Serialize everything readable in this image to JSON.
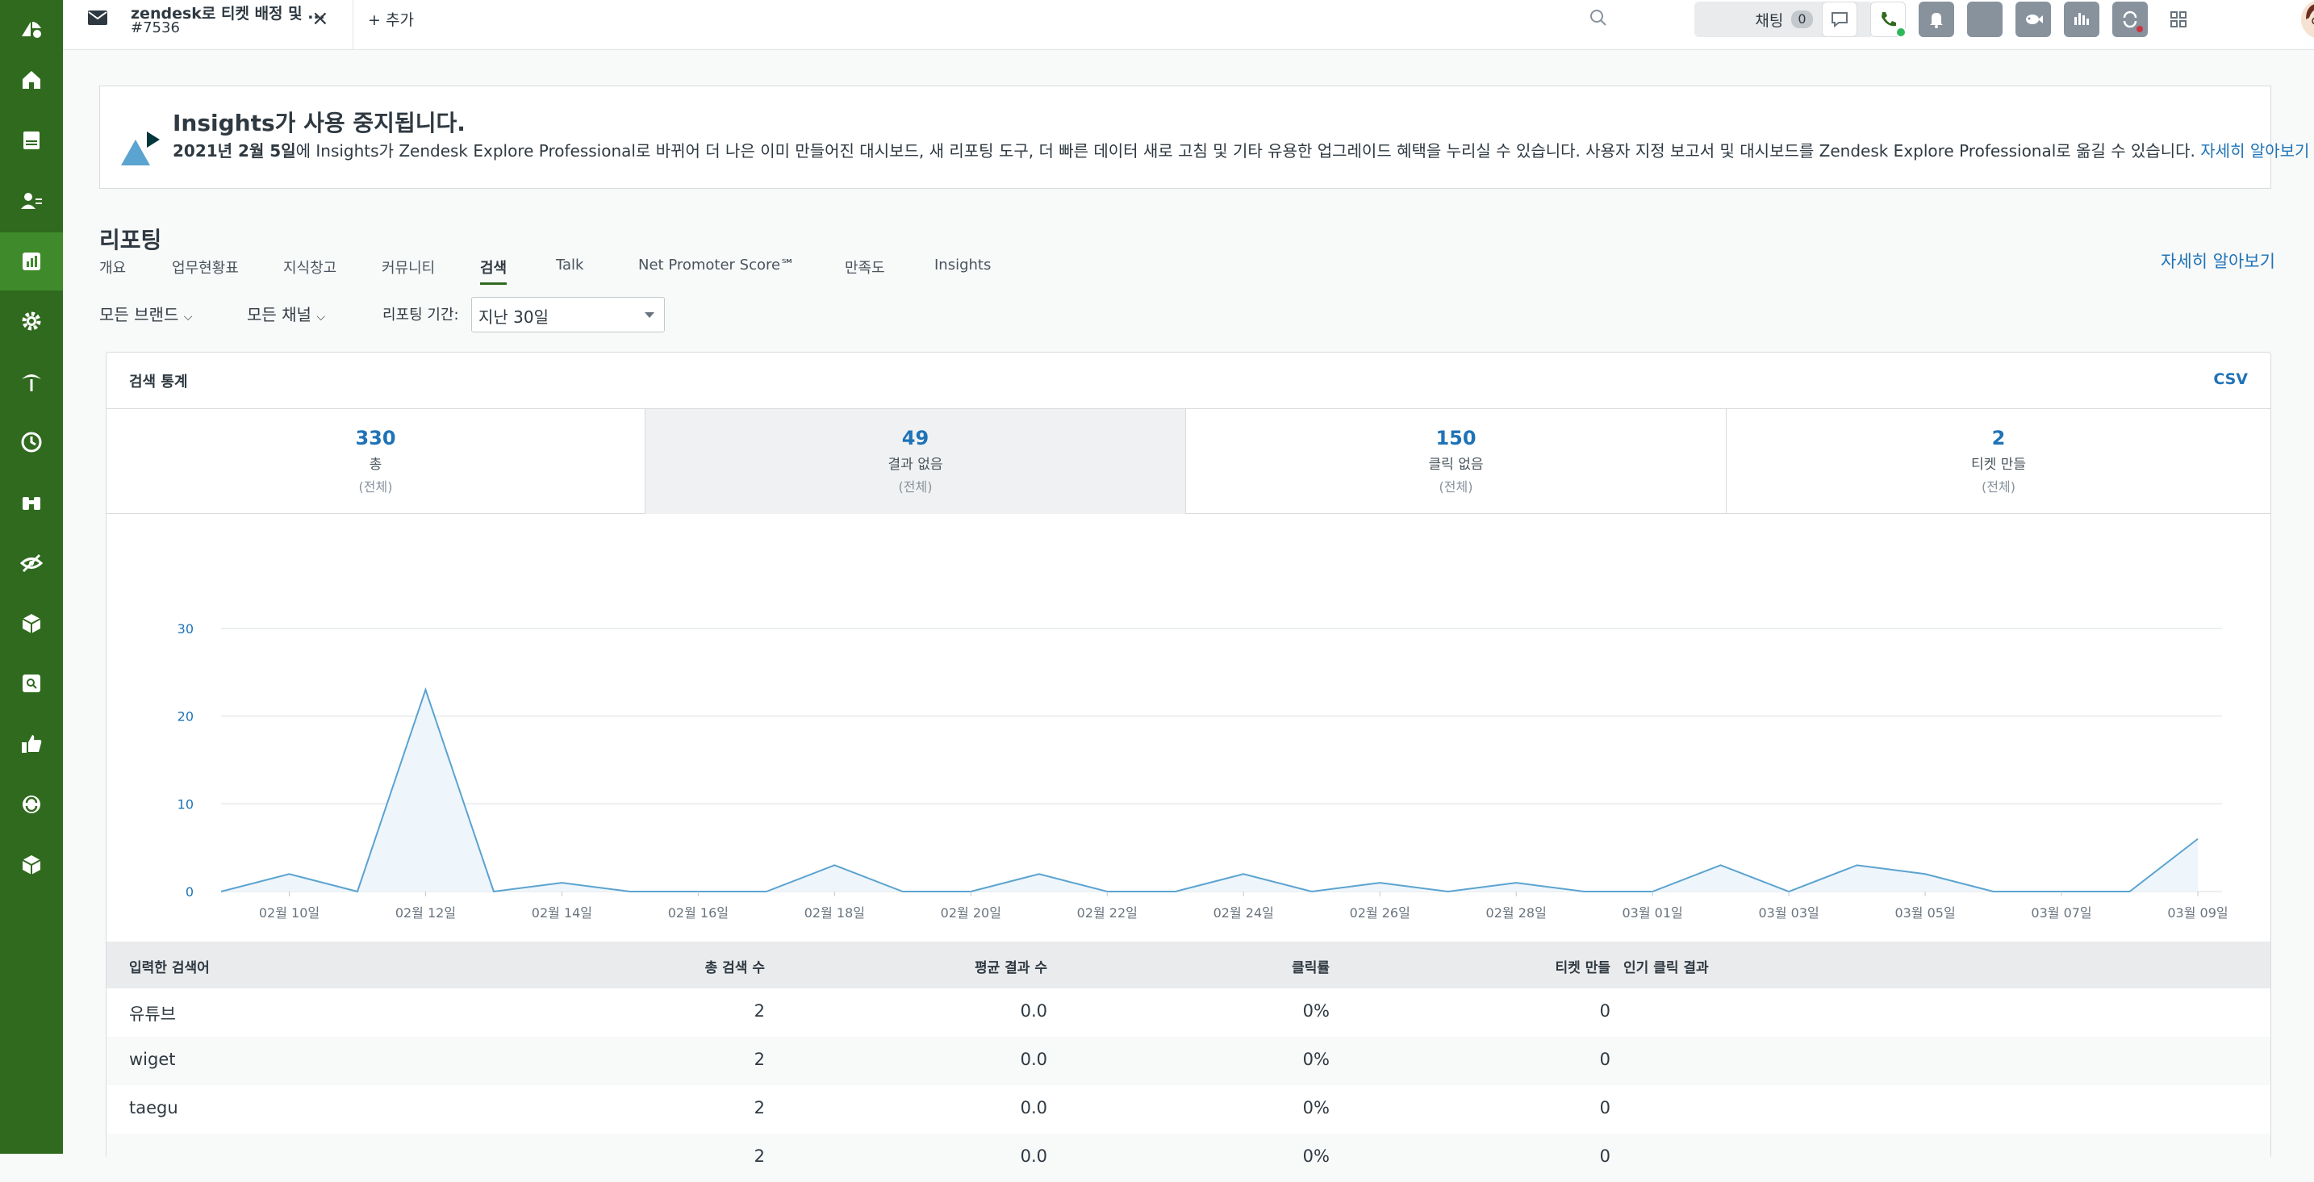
{
  "topbar": {
    "ticket_title": "zendesk로 티켓 배정 및 ...",
    "ticket_number": "#7536",
    "add_label": "+ 추가",
    "chat_label": "채팅",
    "chat_count": "0"
  },
  "banner": {
    "title": "Insights가 사용 중지됩니다.",
    "date": "2021년 2월 5일",
    "body": "에 Insights가 Zendesk Explore Professional로 바뀌어 더 나은 이미 만들어진 대시보드, 새 리포팅 도구, 더 빠른 데이터 새로 고침 및 기타 유용한 업그레이드 혜택을 누리실 수 있습니다. 사용자 지정 보고서 및 대시보드를 Zendesk Explore Professional로 옮길 수 있습니다.",
    "link": "자세히 알아보기"
  },
  "page": {
    "title": "리포팅",
    "learn_more": "자세히 알아보기",
    "tabs": [
      "개요",
      "업무현황표",
      "지식창고",
      "커뮤니티",
      "검색",
      "Talk",
      "Net Promoter Score℠",
      "만족도",
      "Insights"
    ],
    "active_tab": "검색"
  },
  "filters": {
    "brand": "모든 브랜드",
    "channel": "모든 채널",
    "period_label": "리포팅 기간:",
    "period_value": "지난 30일"
  },
  "panel": {
    "title": "검색 통계",
    "csv": "CSV",
    "stats": [
      {
        "value": "330",
        "label": "총",
        "sub": "(전체)"
      },
      {
        "value": "49",
        "label": "결과 없음",
        "sub": "(전체)"
      },
      {
        "value": "150",
        "label": "클릭 없음",
        "sub": "(전체)"
      },
      {
        "value": "2",
        "label": "티켓 만들",
        "sub": "(전체)"
      }
    ]
  },
  "chart_data": {
    "type": "area",
    "x": [
      "02월 09일",
      "02월 10일",
      "02월 11일",
      "02월 12일",
      "02월 13일",
      "02월 14일",
      "02월 15일",
      "02월 16일",
      "02월 17일",
      "02월 18일",
      "02월 19일",
      "02월 20일",
      "02월 21일",
      "02월 22일",
      "02월 23일",
      "02월 24일",
      "02월 25일",
      "02월 26일",
      "02월 27일",
      "02월 28일",
      "02월 29일",
      "03월 01일",
      "03월 02일",
      "03월 03일",
      "03월 04일",
      "03월 05일",
      "03월 06일",
      "03월 07일",
      "03월 08일",
      "03월 09일"
    ],
    "tick_labels": [
      "02월 10일",
      "02월 12일",
      "02월 14일",
      "02월 16일",
      "02월 18일",
      "02월 20일",
      "02월 22일",
      "02월 24일",
      "02월 26일",
      "02월 28일",
      "03월 01일",
      "03월 03일",
      "03월 05일",
      "03월 07일",
      "03월 09일"
    ],
    "values": [
      0,
      2,
      0,
      23,
      0,
      1,
      0,
      0,
      0,
      3,
      0,
      0,
      2,
      0,
      0,
      2,
      0,
      1,
      0,
      1,
      0,
      0,
      3,
      0,
      3,
      2,
      0,
      0,
      0,
      6
    ],
    "yticks": [
      0,
      10,
      20,
      30
    ],
    "ylim": [
      0,
      32
    ],
    "grid": true,
    "line_color": "#5ba3d0",
    "fill_color": "#eef5fb"
  },
  "table": {
    "headers": [
      "입력한 검색어",
      "총 검색 수",
      "평균 결과 수",
      "클릭률",
      "티켓 만들",
      "인기 클릭 결과"
    ],
    "rows": [
      [
        "유튜브",
        "2",
        "0.0",
        "0%",
        "0",
        ""
      ],
      [
        "wiget",
        "2",
        "0.0",
        "0%",
        "0",
        ""
      ],
      [
        "taegu",
        "2",
        "0.0",
        "0%",
        "0",
        ""
      ],
      [
        "",
        "2",
        "0.0",
        "0%",
        "0",
        ""
      ]
    ]
  }
}
